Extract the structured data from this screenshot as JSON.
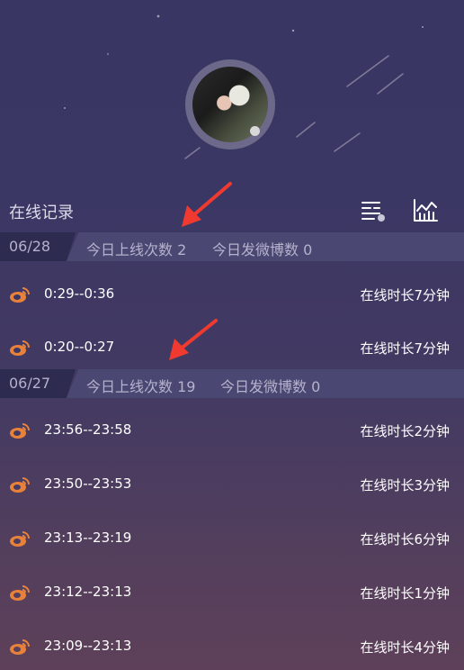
{
  "header": {
    "title": "在线记录",
    "filter_icon": "filter-settings-icon",
    "chart_icon": "line-chart-icon"
  },
  "colors": {
    "accent_orange": "#e8813a",
    "annotation_red": "#f03a2f"
  },
  "days": [
    {
      "date": "06/28",
      "online_count": "今日上线次数 2",
      "weibo_count": "今日发微博数 0",
      "sessions": [
        {
          "time": "0:29--0:36",
          "duration": "在线时长7分钟"
        },
        {
          "time": "0:20--0:27",
          "duration": "在线时长7分钟"
        }
      ]
    },
    {
      "date": "06/27",
      "online_count": "今日上线次数 19",
      "weibo_count": "今日发微博数 0",
      "sessions": [
        {
          "time": "23:56--23:58",
          "duration": "在线时长2分钟"
        },
        {
          "time": "23:50--23:53",
          "duration": "在线时长3分钟"
        },
        {
          "time": "23:13--23:19",
          "duration": "在线时长6分钟"
        },
        {
          "time": "23:12--23:13",
          "duration": "在线时长1分钟"
        },
        {
          "time": "23:09--23:13",
          "duration": "在线时长4分钟"
        }
      ]
    }
  ]
}
